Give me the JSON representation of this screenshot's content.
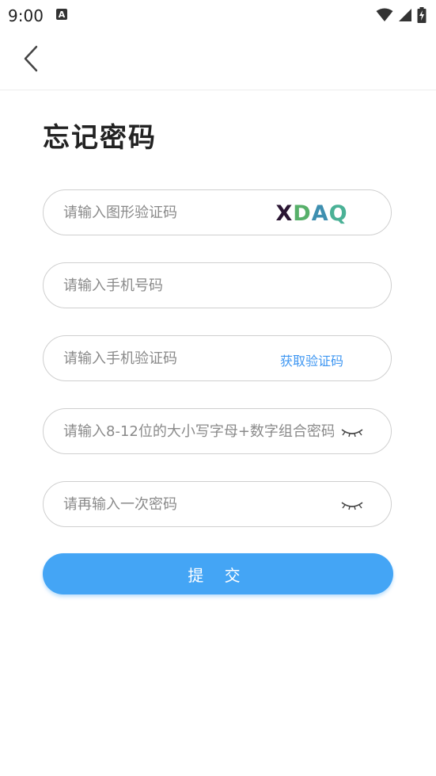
{
  "status_bar": {
    "time": "9:00",
    "notif_icon": "A"
  },
  "header": {
    "back_icon": "chevron-left-icon"
  },
  "title": "忘记密码",
  "form": {
    "captcha": {
      "placeholder": "请输入图形验证码",
      "captcha_text": [
        "X",
        "D",
        "A",
        "Q"
      ],
      "captcha_colors": [
        "#2a1533",
        "#57b06a",
        "#3e8fb0",
        "#4ab196"
      ]
    },
    "phone": {
      "placeholder": "请输入手机号码"
    },
    "sms": {
      "placeholder": "请输入手机验证码",
      "get_code_label": "获取验证码"
    },
    "password": {
      "placeholder": "请输入8-12位的大小写字母+数字组合密码"
    },
    "confirm": {
      "placeholder": "请再输入一次密码"
    }
  },
  "submit_label": "提 交",
  "colors": {
    "accent": "#44a5f5",
    "link": "#3f97f2"
  }
}
